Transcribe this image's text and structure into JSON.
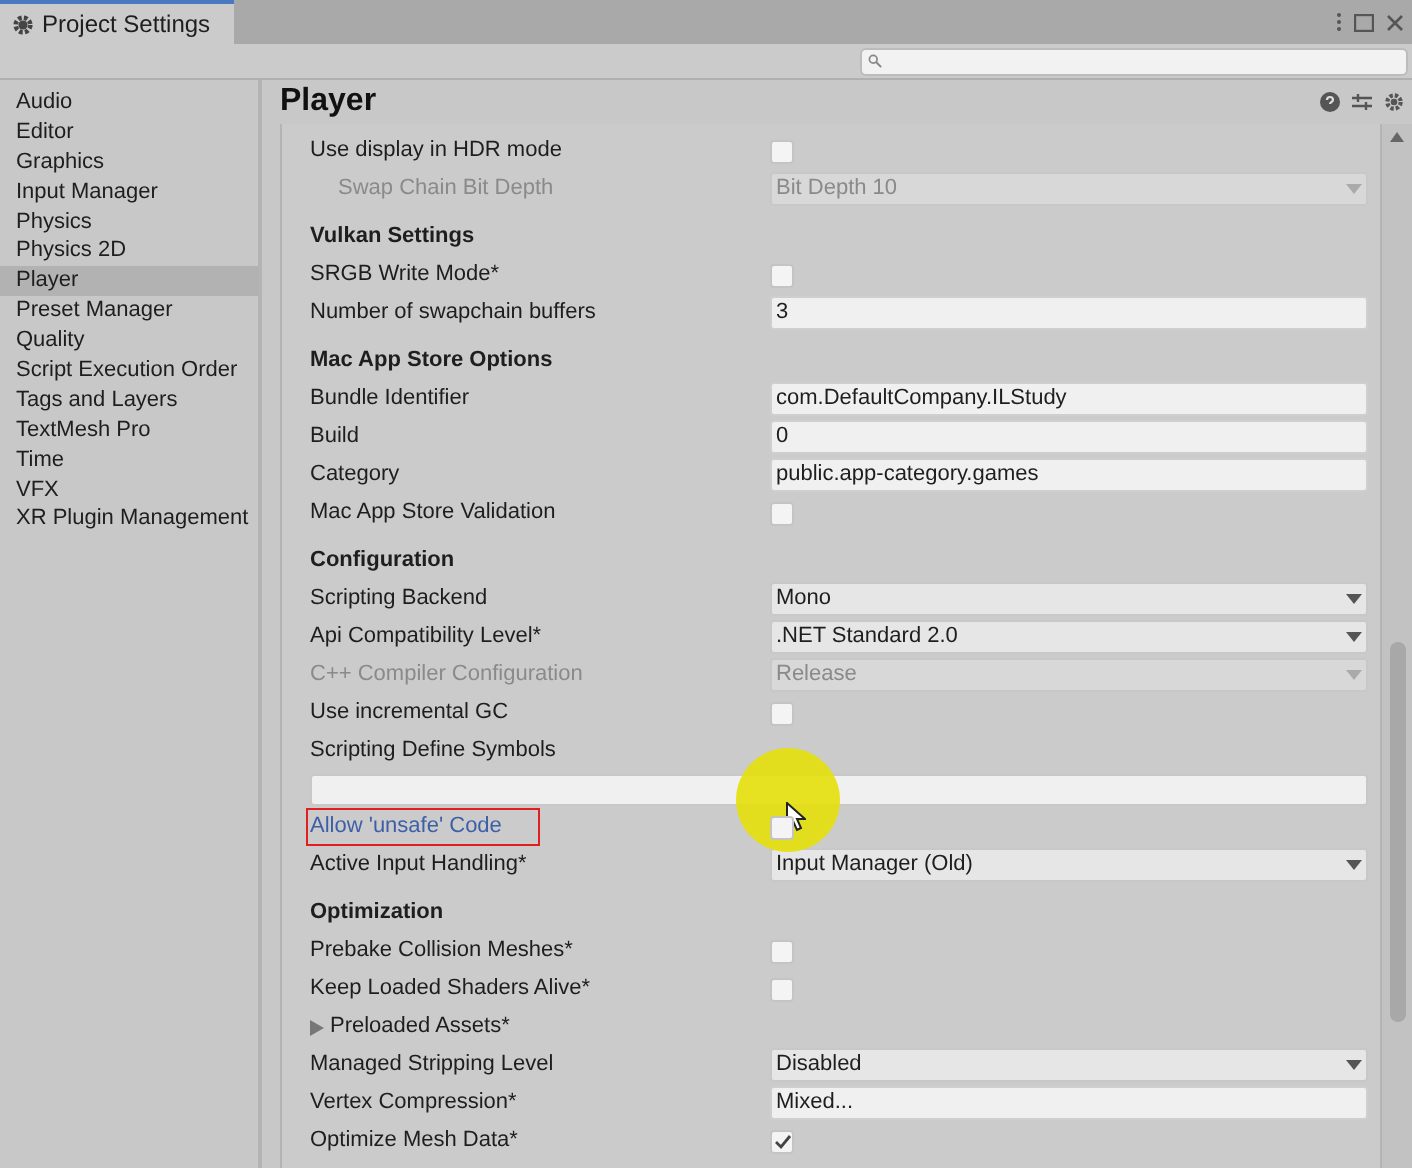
{
  "window": {
    "title": "Project Settings"
  },
  "sidebar": {
    "items": [
      {
        "label": "Audio",
        "selected": false
      },
      {
        "label": "Editor",
        "selected": false
      },
      {
        "label": "Graphics",
        "selected": false
      },
      {
        "label": "Input Manager",
        "selected": false
      },
      {
        "label": "Physics",
        "selected": false
      },
      {
        "label": "Physics 2D",
        "selected": false
      },
      {
        "label": "Player",
        "selected": true
      },
      {
        "label": "Preset Manager",
        "selected": false
      },
      {
        "label": "Quality",
        "selected": false
      },
      {
        "label": "Script Execution Order",
        "selected": false
      },
      {
        "label": "Tags and Layers",
        "selected": false
      },
      {
        "label": "TextMesh Pro",
        "selected": false
      },
      {
        "label": "Time",
        "selected": false
      },
      {
        "label": "VFX",
        "selected": false
      },
      {
        "label": "XR Plugin Management",
        "selected": false
      }
    ]
  },
  "panel": {
    "title": "Player"
  },
  "rows": [
    {
      "kind": "checkbox",
      "label": "Use display in HDR mode",
      "checked": false,
      "disabled": false
    },
    {
      "kind": "dropdown",
      "label": "Swap Chain Bit Depth",
      "value": "Bit Depth 10",
      "disabled": true,
      "indent": true
    },
    {
      "kind": "header",
      "label": "Vulkan Settings"
    },
    {
      "kind": "checkbox",
      "label": "SRGB Write Mode*",
      "checked": false,
      "disabled": false
    },
    {
      "kind": "text",
      "label": "Number of swapchain buffers",
      "value": "3"
    },
    {
      "kind": "header",
      "label": "Mac App Store Options"
    },
    {
      "kind": "text",
      "label": "Bundle Identifier",
      "value": "com.DefaultCompany.ILStudy"
    },
    {
      "kind": "text",
      "label": "Build",
      "value": "0"
    },
    {
      "kind": "text",
      "label": "Category",
      "value": "public.app-category.games"
    },
    {
      "kind": "checkbox",
      "label": "Mac App Store Validation",
      "checked": false,
      "disabled": false
    },
    {
      "kind": "header",
      "label": "Configuration"
    },
    {
      "kind": "dropdown",
      "label": "Scripting Backend",
      "value": "Mono",
      "disabled": false
    },
    {
      "kind": "dropdown",
      "label": "Api Compatibility Level*",
      "value": ".NET Standard 2.0",
      "disabled": false
    },
    {
      "kind": "dropdown",
      "label": "C++ Compiler Configuration",
      "value": "Release",
      "disabled": true
    },
    {
      "kind": "checkbox",
      "label": "Use incremental GC",
      "checked": false,
      "disabled": false
    },
    {
      "kind": "label",
      "label": "Scripting Define Symbols"
    },
    {
      "kind": "wide"
    },
    {
      "kind": "checkbox",
      "label": "Allow 'unsafe' Code",
      "checked": false,
      "disabled": false,
      "highlighted": true
    },
    {
      "kind": "dropdown",
      "label": "Active Input Handling*",
      "value": "Input Manager (Old)",
      "disabled": false
    },
    {
      "kind": "header",
      "label": "Optimization"
    },
    {
      "kind": "checkbox",
      "label": "Prebake Collision Meshes*",
      "checked": false,
      "disabled": false
    },
    {
      "kind": "checkbox",
      "label": "Keep Loaded Shaders Alive*",
      "checked": false,
      "disabled": false
    },
    {
      "kind": "foldout",
      "label": "Preloaded Assets*",
      "expanded": false
    },
    {
      "kind": "dropdown",
      "label": "Managed Stripping Level",
      "value": "Disabled",
      "disabled": false
    },
    {
      "kind": "text",
      "label": "Vertex Compression*",
      "value": "Mixed..."
    },
    {
      "kind": "checkbox",
      "label": "Optimize Mesh Data*",
      "checked": true,
      "disabled": false
    }
  ]
}
